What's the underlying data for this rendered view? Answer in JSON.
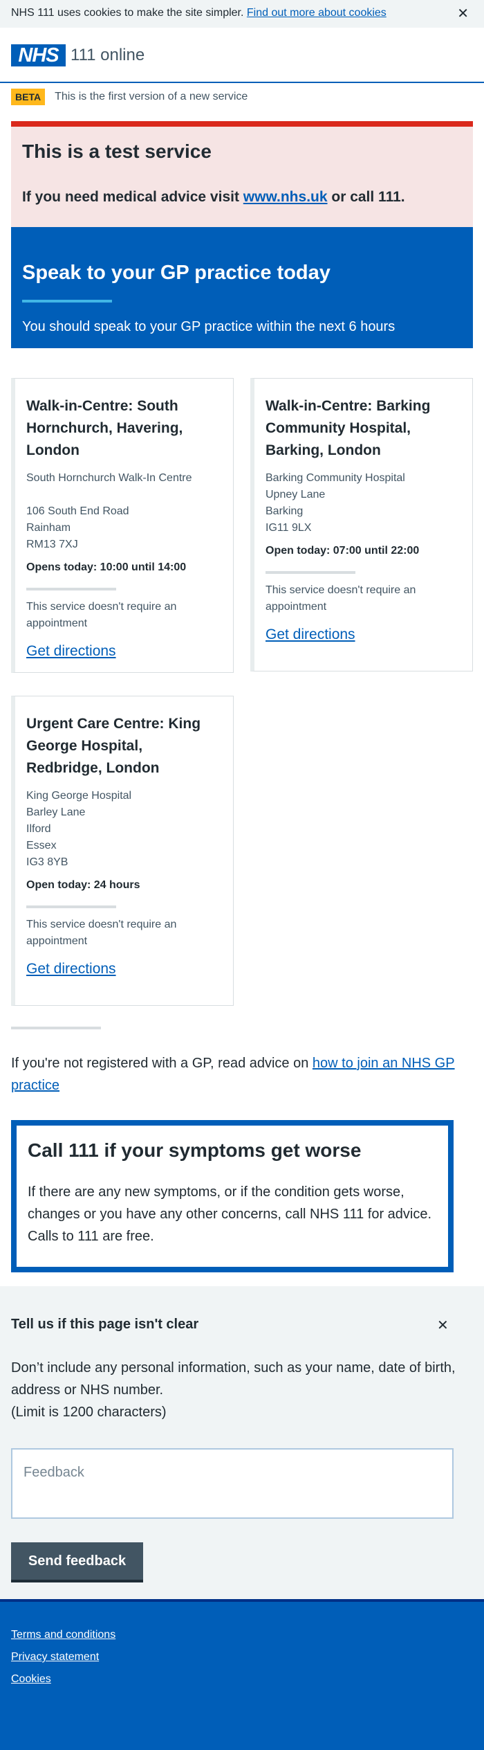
{
  "cookie_banner": {
    "text": "NHS 111 uses cookies to make the site simpler.",
    "link": "Find out more about cookies",
    "close": "✕"
  },
  "header": {
    "logo": "NHS",
    "service": "111 online"
  },
  "beta": {
    "tag": "BETA",
    "text": "This is the first version of a new service"
  },
  "test_banner": {
    "title": "This is a test service",
    "text_before": "If you need medical advice visit ",
    "link": "www.nhs.uk",
    "text_after": " or call 111."
  },
  "hero": {
    "title": "Speak to your GP practice today",
    "subtitle": "You should speak to your GP practice within the next 6 hours"
  },
  "services": [
    {
      "title": "Walk-in-Centre: South Hornchurch, Havering, London",
      "address": [
        "South Hornchurch Walk-In Centre",
        "",
        "106 South End Road",
        "Rainham",
        "RM13 7XJ"
      ],
      "hours": "Opens today: 10:00 until 14:00",
      "appointment": "This service doesn't require an appointment",
      "directions": "Get directions"
    },
    {
      "title": "Walk-in-Centre: Barking Community Hospital, Barking, London",
      "address": [
        "Barking Community Hospital",
        "Upney Lane",
        "Barking",
        "IG11 9LX"
      ],
      "hours": "Open today: 07:00 until 22:00",
      "appointment": "This service doesn't require an appointment",
      "directions": "Get directions"
    },
    {
      "title": "Urgent Care Centre: King George Hospital, Redbridge, London",
      "address": [
        "King George Hospital",
        "Barley Lane",
        "Ilford",
        "Essex",
        "IG3 8YB"
      ],
      "hours": "Open today: 24 hours",
      "appointment": "This service doesn't require an appointment",
      "directions": "Get directions"
    }
  ],
  "gp_info": {
    "text": "If you're not registered with a GP, read advice on ",
    "link": "how to join an NHS GP practice"
  },
  "call_111": {
    "title": "Call 111 if your symptoms get worse",
    "text": "If there are any new symptoms, or if the condition gets worse, changes or you have any other concerns, call NHS 111 for advice. Calls to 111 are free."
  },
  "feedback": {
    "title": "Tell us if this page isn't clear",
    "close": "✕",
    "info": "Don’t include any personal information, such as your name, date of birth, address or NHS number.",
    "limit": "(Limit is 1200 characters)",
    "placeholder": "Feedback",
    "button": "Send feedback"
  },
  "footer": {
    "links": [
      "Terms and conditions",
      "Privacy statement",
      "Cookies"
    ]
  },
  "colors": {
    "nhs_blue": "#005eb8",
    "beta_yellow": "#ffb81c",
    "test_red": "#da291c",
    "hero_bar": "#41b6e6"
  }
}
